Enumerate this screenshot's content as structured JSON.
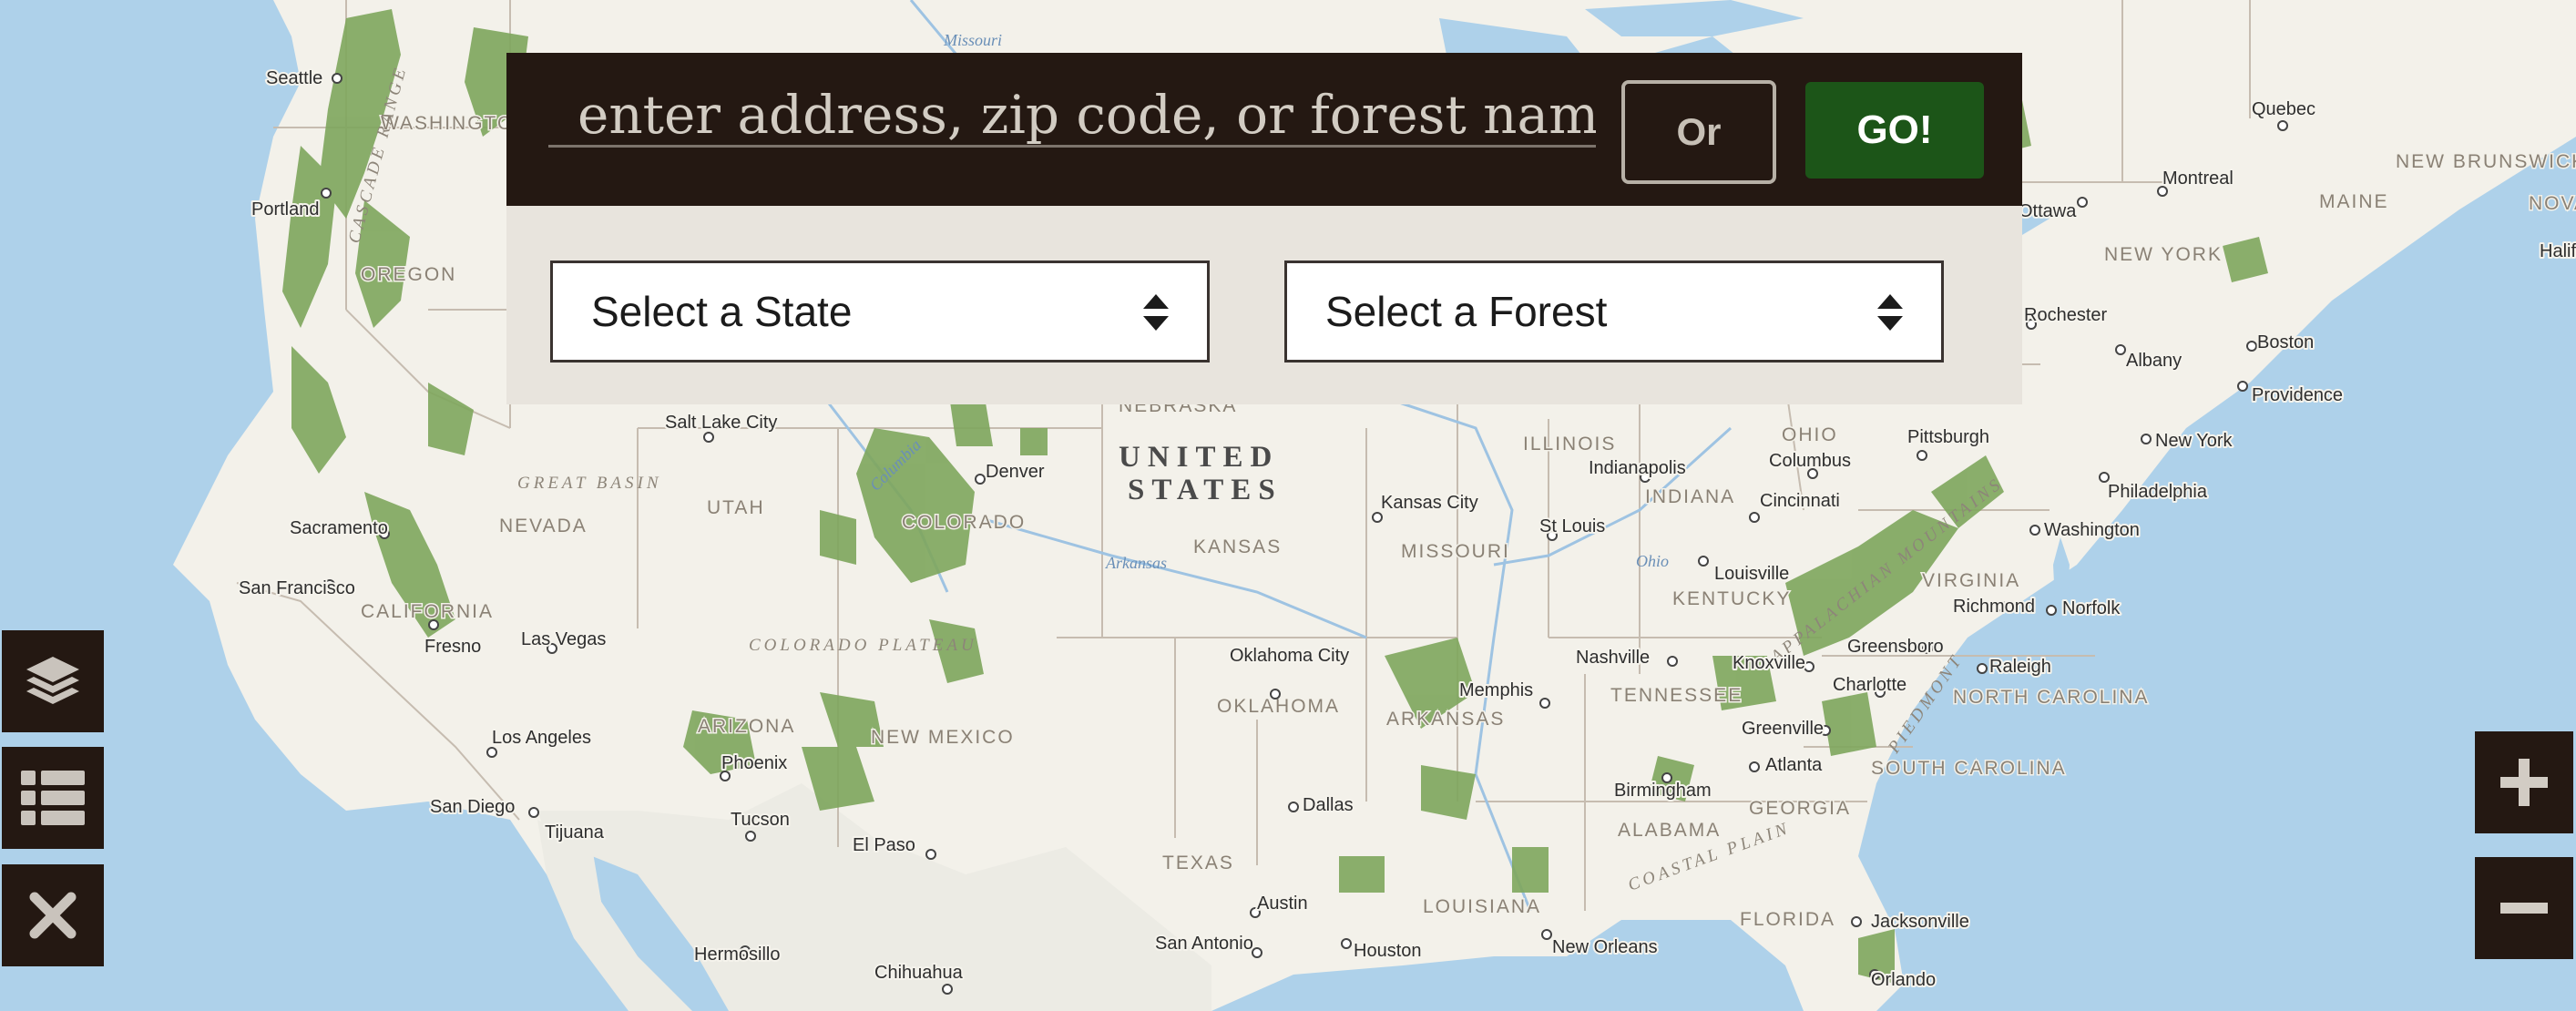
{
  "search": {
    "placeholder": "enter address, zip code, or forest name",
    "or_label": "Or",
    "go_label": "GO!"
  },
  "filters": {
    "state_label": "Select a State",
    "forest_label": "Select a Forest"
  },
  "controls": {
    "layers": "layers-icon",
    "list": "list-icon",
    "close": "close-icon",
    "zoom_in": "plus-icon",
    "zoom_out": "minus-icon"
  },
  "colors": {
    "panel_dark": "#241812",
    "go_green": "#1c5518",
    "panel_light": "#e8e4dd",
    "forest_green": "#7ea65d"
  },
  "map": {
    "country": [
      "UNITED",
      "STATES"
    ],
    "cities": [
      "Seattle",
      "Portland",
      "Sacramento",
      "San Francisco",
      "Fresno",
      "Las Vegas",
      "Los Angeles",
      "San Diego",
      "Tijuana",
      "Hermosillo",
      "Chihuahua",
      "Tucson",
      "Phoenix",
      "El Paso",
      "Salt Lake City",
      "Denver",
      "Kansas City",
      "St Louis",
      "Indianapolis",
      "Columbus",
      "Cincinnati",
      "Pittsburgh",
      "Louisville",
      "Nashville",
      "Knoxville",
      "Memphis",
      "Oklahoma City",
      "Dallas",
      "Austin",
      "San Antonio",
      "Houston",
      "New Orleans",
      "Birmingham",
      "Atlanta",
      "Greenville",
      "Charlotte",
      "Greensboro",
      "Raleigh",
      "Richmond",
      "Norfolk",
      "Washington",
      "Philadelphia",
      "New York",
      "Providence",
      "Boston",
      "Albany",
      "Rochester",
      "Montreal",
      "Ottawa",
      "Quebec",
      "Halifax",
      "Jacksonville",
      "Orlando"
    ],
    "states": [
      "WASHINGTON",
      "OREGON",
      "NEVADA",
      "CALIFORNIA",
      "UTAH",
      "COLORADO",
      "ARIZONA",
      "NEW MEXICO",
      "NEBRASKA",
      "KANSAS",
      "MISSOURI",
      "OKLAHOMA",
      "TEXAS",
      "ARKANSAS",
      "LOUISIANA",
      "ILLINOIS",
      "INDIANA",
      "OHIO",
      "KENTUCKY",
      "TENNESSEE",
      "VIRGINIA",
      "NORTH CAROLINA",
      "SOUTH CAROLINA",
      "GEORGIA",
      "ALABAMA",
      "FLORIDA",
      "NEW YORK",
      "MAINE",
      "NEW BRUNSWICK",
      "NOVA SCOTIA"
    ],
    "regions": [
      "GREAT BASIN",
      "COLORADO PLATEAU",
      "APPALACHIAN MOUNTAINS",
      "PIEDMONT",
      "COASTAL PLAIN",
      "CASCADE RANGE"
    ],
    "water": [
      "Missouri",
      "Arkansas",
      "Ohio",
      "Columbia"
    ]
  }
}
